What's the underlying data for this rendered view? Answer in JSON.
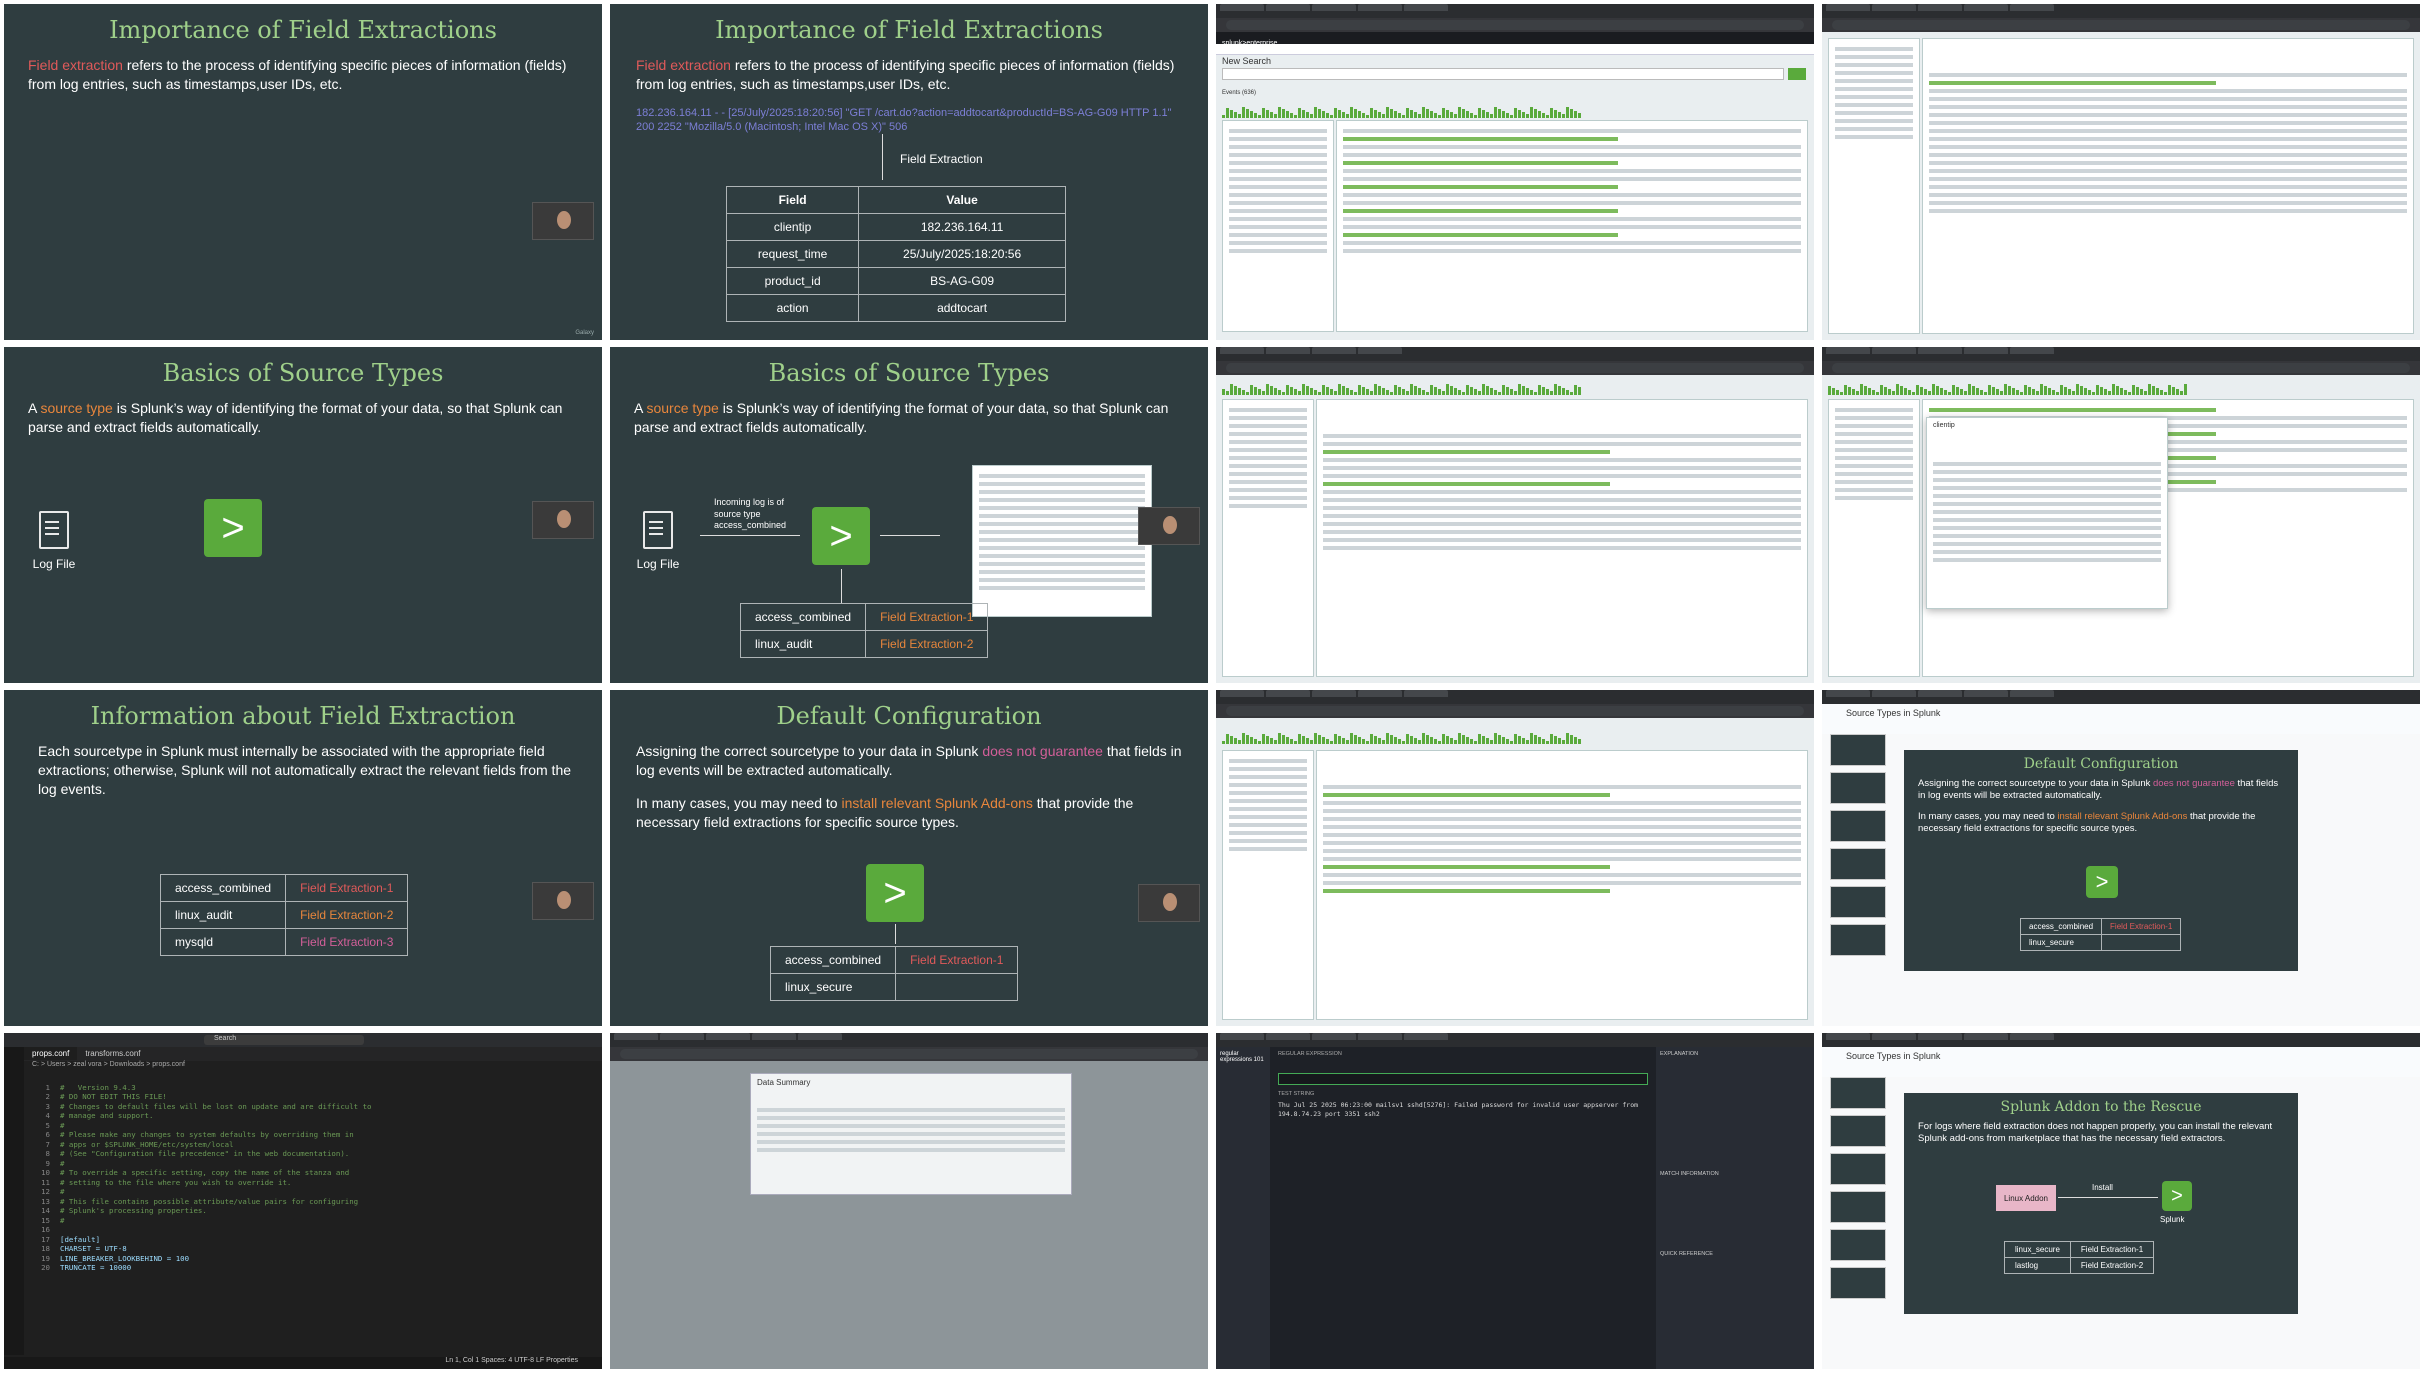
{
  "tiles": {
    "t1": {
      "title": "Importance of Field Extractions",
      "term": "Field extraction",
      "text": " refers to the process of identifying specific pieces of information (fields) from log entries, such as timestamps,user IDs, etc.",
      "watermark": "Galaxy"
    },
    "t2": {
      "title": "Importance of Field Extractions",
      "term": "Field extraction",
      "text": " refers to the process of identifying specific pieces of information (fields) from log entries, such as timestamps,user IDs, etc.",
      "log_line": "182.236.164.11 - - [25/July/2025:18:20:56] \"GET /cart.do?action=addtocart&productId=BS-AG-G09 HTTP 1.1\" 200 2252 \"Mozilla/5.0 (Macintosh; Intel Mac OS X)\" 506",
      "arrow_label": "Field Extraction",
      "table_header": [
        "Field",
        "Value"
      ],
      "rows": [
        {
          "field": "clientip",
          "value": "182.236.164.11"
        },
        {
          "field": "request_time",
          "value": "25/July/2025:18:20:56"
        },
        {
          "field": "product_id",
          "value": "BS-AG-G09"
        },
        {
          "field": "action",
          "value": "addtocart"
        }
      ]
    },
    "t3": {
      "app": "splunk>enterprise",
      "page_title": "New Search",
      "tab": "Events (636)"
    },
    "t5": {
      "title": "Basics of Source Types",
      "prefix": "A ",
      "term": "source type",
      "text": " is Splunk’s way of identifying the format of your data, so that Splunk can parse and extract fields automatically.",
      "log_label": "Log File"
    },
    "t6": {
      "title": "Basics of Source Types",
      "prefix": "A ",
      "term": "source type",
      "text": " is Splunk’s way of identifying the format of your data, so that Splunk can parse and extract fields automatically.",
      "log_label": "Log File",
      "incoming": "Incoming log is of source type access_combined",
      "rows": [
        {
          "k": "access_combined",
          "v": "Field Extraction-1"
        },
        {
          "k": "linux_audit",
          "v": "Field Extraction-2"
        }
      ]
    },
    "t8": {
      "panel_title": "clientip"
    },
    "t9": {
      "title": "Information about Field Extraction",
      "text": "Each sourcetype in Splunk must internally be associated with the appropriate field extractions; otherwise, Splunk will not automatically extract the relevant fields from the log events.",
      "rows": [
        {
          "k": "access_combined",
          "v": "Field Extraction-1"
        },
        {
          "k": "linux_audit",
          "v": "Field Extraction-2"
        },
        {
          "k": "mysqld",
          "v": "Field Extraction-3"
        }
      ]
    },
    "t10": {
      "title": "Default Configuration",
      "p1a": "Assigning the correct sourcetype to your data in Splunk ",
      "p1b": "does not guarantee",
      "p1c": " that fields in log events will be extracted automatically.",
      "p2a": "In many cases, you may need to ",
      "p2b": "install relevant Splunk Add-ons",
      "p2c": " that provide the necessary field extractions for specific source types.",
      "rows": [
        {
          "k": "access_combined",
          "v": "Field Extraction-1"
        },
        {
          "k": "linux_secure",
          "v": ""
        }
      ]
    },
    "t12": {
      "doc_title": "Source Types in Splunk",
      "slide_title": "Default Configuration",
      "p1a": "Assigning the correct sourcetype to your data in Splunk ",
      "p1b": "does not guarantee",
      "p1c": " that fields in log events will be extracted automatically.",
      "p2a": "In many cases, you may need to ",
      "p2b": "install relevant Splunk Add-ons",
      "p2c": " that provide the necessary field extractions for specific source types.",
      "rows": [
        {
          "k": "access_combined",
          "v": "Field Extraction-1"
        },
        {
          "k": "linux_secure",
          "v": ""
        }
      ]
    },
    "t13": {
      "tab1": "props.conf",
      "tab2": "transforms.conf",
      "crumb": "C: > Users > zeal vora > Downloads > props.conf",
      "search": "Search",
      "lines": [
        "#   Version 9.4.3",
        "# DO NOT EDIT THIS FILE!",
        "# Changes to default files will be lost on update and are difficult to",
        "# manage and support.",
        "#",
        "# Please make any changes to system defaults by overriding them in",
        "# apps or $SPLUNK_HOME/etc/system/local",
        "# (See \"Configuration file precedence\" in the web documentation).",
        "#",
        "# To override a specific setting, copy the name of the stanza and",
        "# setting to the file where you wish to override it.",
        "#",
        "# This file contains possible attribute/value pairs for configuring",
        "# Splunk's processing properties.",
        "#",
        "",
        "[default]",
        "CHARSET = UTF-8",
        "LINE_BREAKER_LOOKBEHIND = 100",
        "TRUNCATE = 10000"
      ],
      "status": "Ln 1, Col 1   Spaces: 4   UTF-8   LF   Properties"
    },
    "t14": {
      "dialog_title": "Data Summary"
    },
    "t15": {
      "logo": "regular expressions 101",
      "test_line": "Thu Jul 25 2025 06:23:00 mailsv1 sshd[5276]: Failed password for invalid user appserver from 194.8.74.23 port 3351 ssh2",
      "section1": "REGULAR EXPRESSION",
      "section2": "TEST STRING",
      "explanation": "EXPLANATION",
      "match_info": "MATCH INFORMATION",
      "quick_ref": "QUICK REFERENCE"
    },
    "t16": {
      "doc_title": "Source Types in Splunk",
      "slide_title": "Splunk Addon to the Rescue",
      "text": "For logs where field extraction does not happen properly, you can install the relevant Splunk add-ons from marketplace that has the necessary field extractors.",
      "addon": "Linux Addon",
      "install": "Install",
      "splunk": "Splunk",
      "rows": [
        {
          "k": "linux_secure",
          "v": "Field Extraction-1"
        },
        {
          "k": "lastlog",
          "v": "Field Extraction-2"
        }
      ]
    }
  }
}
